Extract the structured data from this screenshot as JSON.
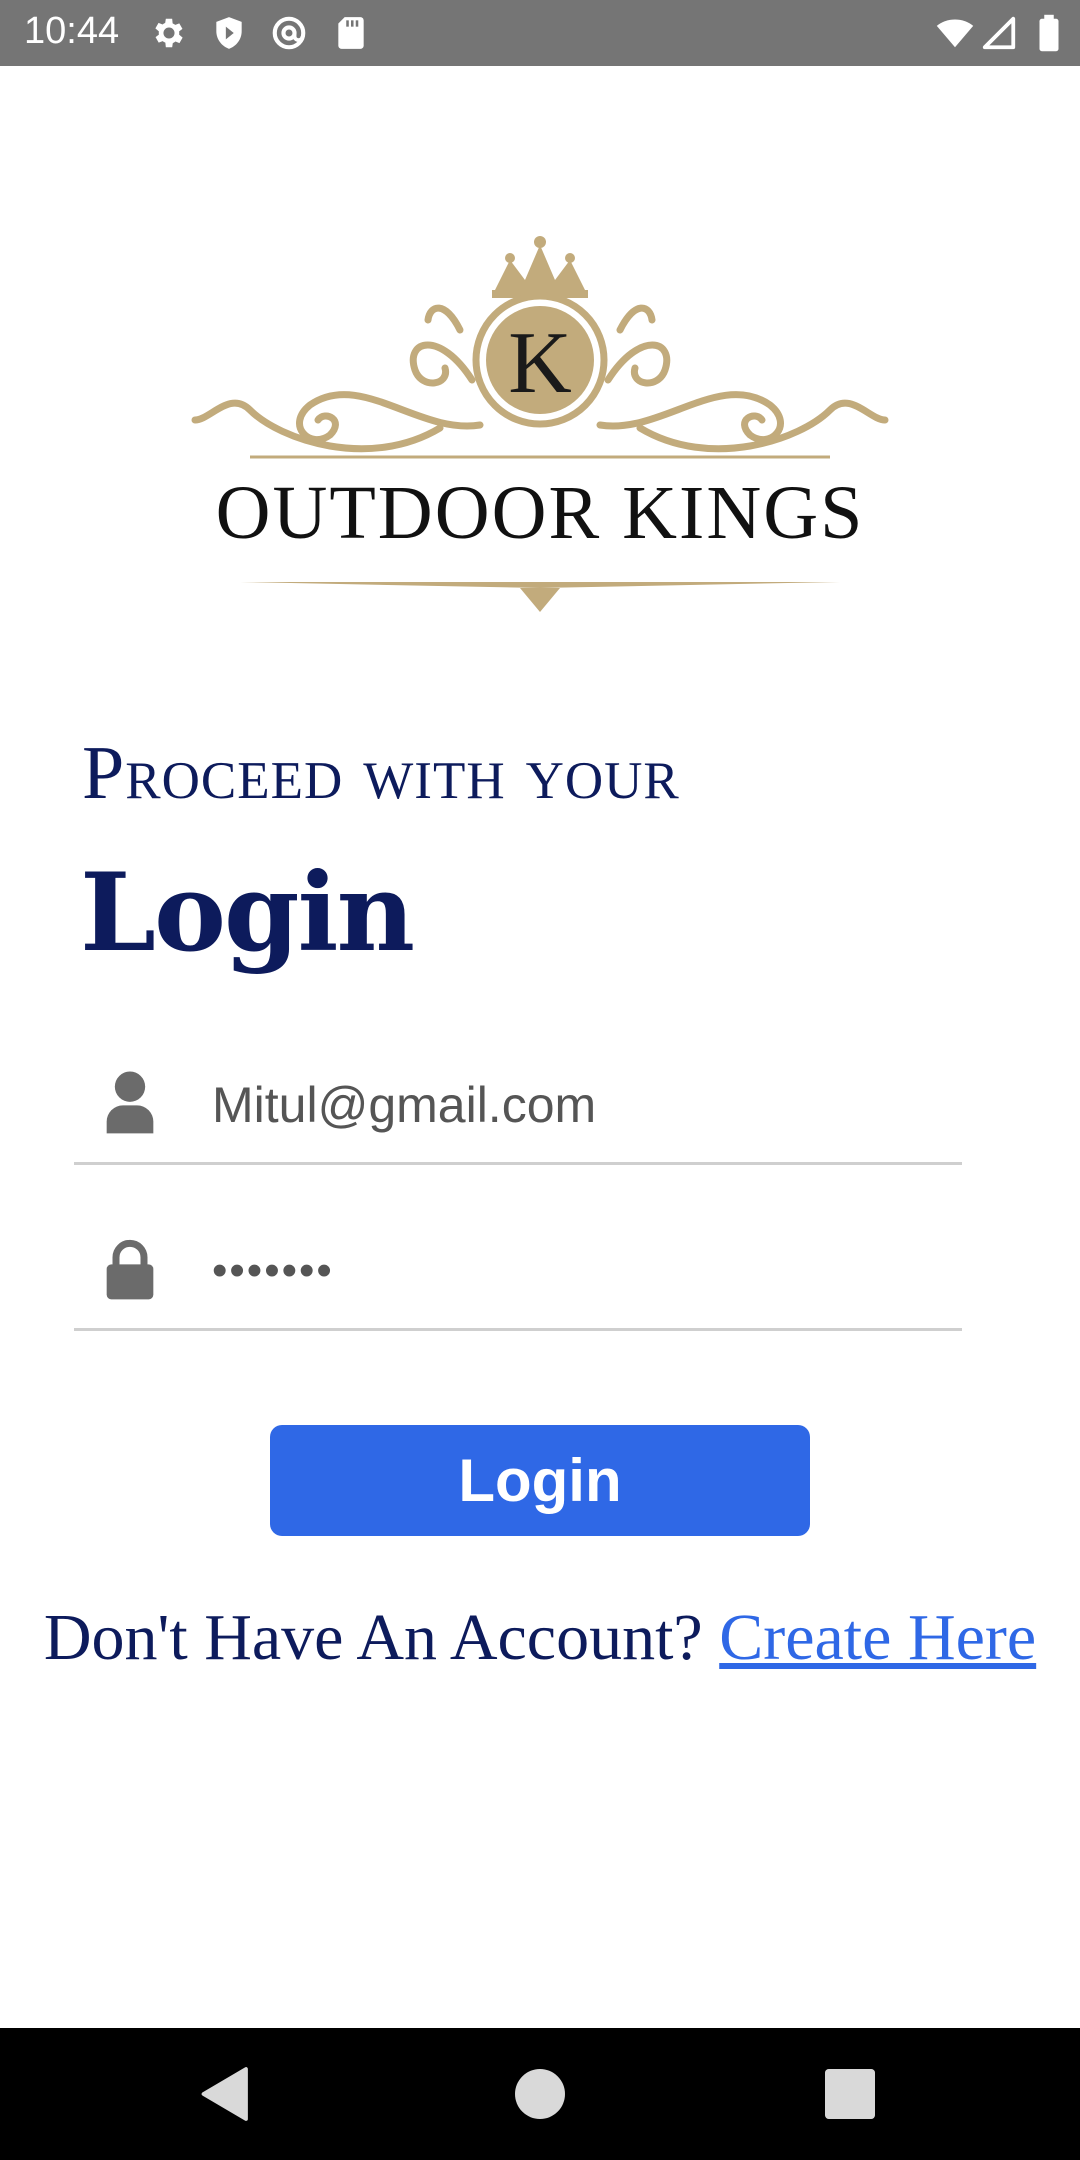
{
  "status_bar": {
    "time": "10:44",
    "left_icons": [
      "gear-icon",
      "shield-icon",
      "at-sign-icon",
      "sd-card-icon"
    ],
    "right_icons": [
      "wifi-icon",
      "signal-icon",
      "battery-icon"
    ],
    "background": "#757575"
  },
  "logo": {
    "brand_name": "OUTDOOR KINGS",
    "monogram": "K",
    "gold_color": "#c2ab7c"
  },
  "heading": {
    "subtitle": "Proceed with your",
    "title": "Login",
    "color": "#0d1b5c"
  },
  "form": {
    "email": {
      "icon": "user-icon",
      "value": "Mitul@gmail.com"
    },
    "password": {
      "icon": "lock-icon",
      "value": "•••••••"
    },
    "login_label": "Login",
    "button_color": "#2f68e6"
  },
  "signup": {
    "prompt": "Don't Have An Account?",
    "link_label": "Create Here"
  },
  "nav_bar": {
    "buttons": [
      "back-icon",
      "home-icon",
      "recents-icon"
    ]
  }
}
